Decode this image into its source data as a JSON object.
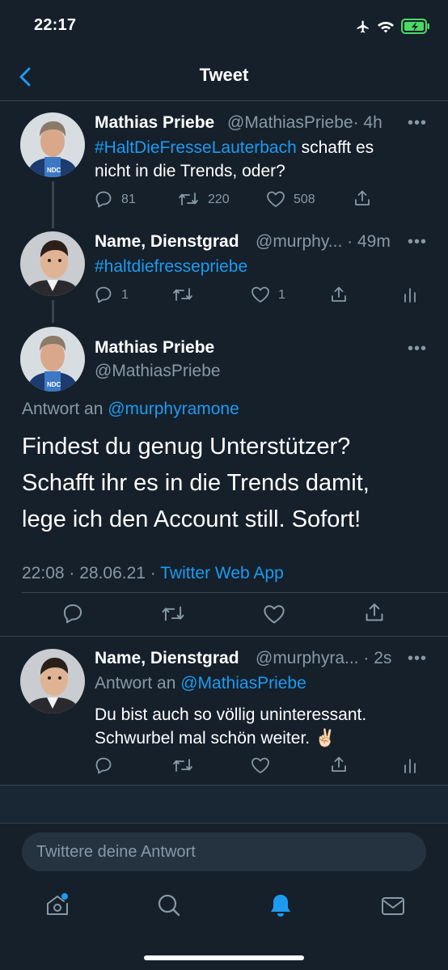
{
  "status_bar": {
    "time": "22:17"
  },
  "header": {
    "title": "Tweet"
  },
  "tweets": [
    {
      "name": "Mathias Priebe",
      "handle": "@MathiasPriebe",
      "time": "· 4h",
      "hashtag": "#HaltDieFresseLauterbach",
      "text_line1": " schafft es",
      "text_line2": "nicht in die Trends, oder?",
      "replies": "81",
      "retweets": "220",
      "likes": "508"
    },
    {
      "name": "Name, Dienstgrad",
      "handle": "@murphy...",
      "time": "· 49m",
      "hashtag": "#haltdiefressepriebe",
      "replies": "1",
      "likes": "1"
    }
  ],
  "main_tweet": {
    "name": "Mathias Priebe",
    "handle": "@MathiasPriebe",
    "reply_prefix": "Antwort an ",
    "reply_to": "@murphyramone",
    "text_line1": "Findest du genug Unterstützer?",
    "text_line2": "Schafft ihr es in die Trends damit,",
    "text_line3": "lege ich den Account still. Sofort!",
    "timestamp": "22:08 · 28.06.21 · ",
    "client": "Twitter Web App"
  },
  "reply_tweet": {
    "name": "Name, Dienstgrad",
    "handle": "@murphyra...",
    "time": "· 2s",
    "reply_prefix": "Antwort an ",
    "reply_to": "@MathiasPriebe",
    "text_line1": "Du bist auch so völlig uninteressant.",
    "text_line2": "Schwurbel mal schön weiter.",
    "emoji": "✌🏻"
  },
  "composer": {
    "placeholder": "Twittere deine Antwort"
  },
  "more_label": "•••",
  "colors": {
    "background": "#15202b",
    "accent": "#1d9bf0",
    "secondary_text": "#8899a6",
    "divider": "#38444d",
    "battery": "#4cd964"
  },
  "icons": [
    "back-chevron-icon",
    "airplane-icon",
    "wifi-icon",
    "battery-icon",
    "reply-icon",
    "retweet-icon",
    "like-icon",
    "share-icon",
    "analytics-icon",
    "home-icon",
    "search-icon",
    "notifications-icon",
    "messages-icon"
  ]
}
